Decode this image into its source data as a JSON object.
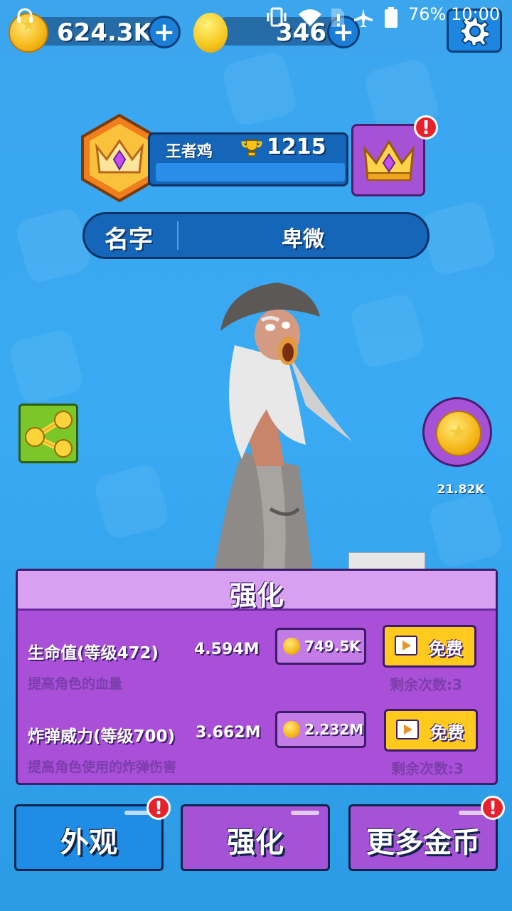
{
  "status_bar": {
    "battery": "76%",
    "time": "10:00"
  },
  "resources": {
    "coins": "624.3K",
    "gems": "346"
  },
  "profile": {
    "player_name": "王者鸡",
    "trophies": "1215",
    "name_label": "名字",
    "name_value": "卑微"
  },
  "side": {
    "coin_bonus": "21.82K"
  },
  "upgrade": {
    "title": "强化",
    "rows": [
      {
        "name": "生命值(等级472)",
        "value": "4.594M",
        "desc": "提高角色的血量",
        "cost": "749.5K",
        "free_label": "免费",
        "remaining": "剩余次数:3"
      },
      {
        "name": "炸弹威力(等级700)",
        "value": "3.662M",
        "desc": "提高角色使用的炸弹伤害",
        "cost": "2.232M",
        "free_label": "免费",
        "remaining": "剩余次数:3"
      }
    ]
  },
  "tabs": [
    {
      "label": "外观",
      "alert": "!"
    },
    {
      "label": "强化"
    },
    {
      "label": "更多金币",
      "alert": "!"
    }
  ],
  "colors": {
    "background": "#3aa8ee",
    "panel_purple": "#a94fd8",
    "button_blue": "#1f8de6",
    "button_yellow": "#ffc91d",
    "alert_red": "#e8222c"
  }
}
